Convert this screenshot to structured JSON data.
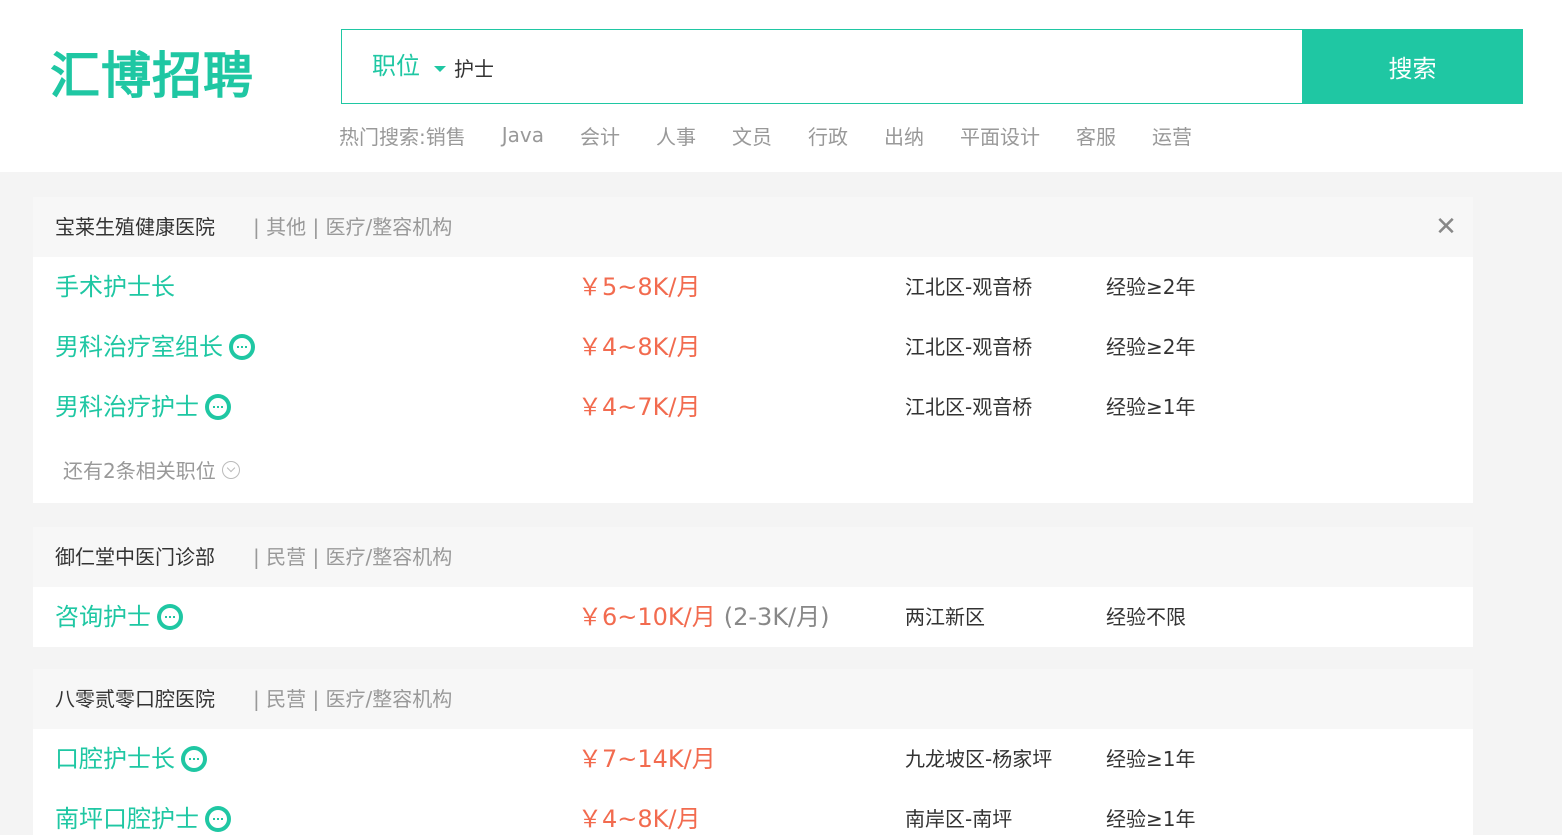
{
  "header": {
    "logo_text": "汇博招聘",
    "search_type": "职位",
    "search_value": "护士",
    "search_button": "搜索",
    "hot_label": "热门搜索:",
    "hot_items": [
      "销售",
      "Java",
      "会计",
      "人事",
      "文员",
      "行政",
      "出纳",
      "平面设计",
      "客服",
      "运营"
    ]
  },
  "companies": [
    {
      "name": "宝莱生殖健康医院",
      "tags": "| 其他 | 医疗/整容机构",
      "close": "✕",
      "jobs": [
        {
          "title": "手术护士长",
          "salary": "￥5~8K/月",
          "location": "江北区-观音桥",
          "exp": "经验≥2年"
        },
        {
          "title": "男科治疗室组长",
          "salary": "￥4~8K/月",
          "location": "江北区-观音桥",
          "exp": "经验≥2年"
        },
        {
          "title": "男科治疗护士",
          "salary": "￥4~7K/月",
          "location": "江北区-观音桥",
          "exp": "经验≥1年"
        }
      ],
      "more": "还有2条相关职位"
    },
    {
      "name": "御仁堂中医门诊部",
      "tags": "| 民营 | 医疗/整容机构",
      "jobs": [
        {
          "title": "咨询护士",
          "salary": "￥6~10K/月",
          "salary_extra": "(2-3K/月)",
          "location": "两江新区",
          "exp": "经验不限"
        }
      ]
    },
    {
      "name": "八零贰零口腔医院",
      "tags": "| 民营 | 医疗/整容机构",
      "jobs": [
        {
          "title": "口腔护士长",
          "salary": "￥7~14K/月",
          "location": "九龙坡区-杨家坪",
          "exp": "经验≥1年"
        },
        {
          "title": "南坪口腔护士",
          "salary": "￥4~8K/月",
          "location": "南岸区-南坪",
          "exp": "经验≥1年"
        }
      ]
    }
  ]
}
